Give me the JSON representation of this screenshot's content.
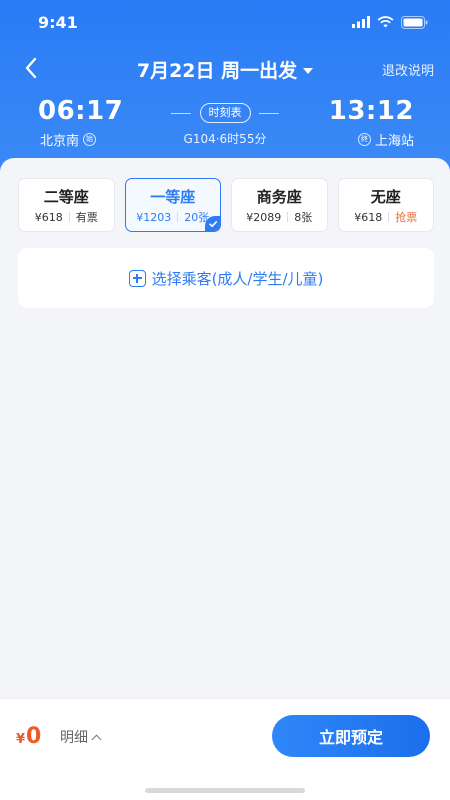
{
  "status_bar": {
    "time": "9:41"
  },
  "nav": {
    "title": "7月22日 周一出发",
    "refund_link": "退改说明"
  },
  "train": {
    "departure_time": "06:17",
    "departure_station": "北京南",
    "departure_badge": "始",
    "arrival_time": "13:12",
    "arrival_station": "上海站",
    "arrival_badge": "终",
    "timetable_label": "时刻表",
    "train_info": "G104·6时55分"
  },
  "seats": [
    {
      "name": "二等座",
      "price": "¥618",
      "availability": "有票",
      "selected": false
    },
    {
      "name": "一等座",
      "price": "¥1203",
      "availability": "20张",
      "selected": true
    },
    {
      "name": "商务座",
      "price": "¥2089",
      "availability": "8张",
      "selected": false
    },
    {
      "name": "无座",
      "price": "¥618",
      "availability": "抢票",
      "selected": false
    }
  ],
  "passenger": {
    "label": "选择乘客(成人/学生/儿童)"
  },
  "footer": {
    "currency": "¥",
    "amount": "0",
    "detail_label": "明细",
    "book_label": "立即预定"
  },
  "colors": {
    "header_blue": "#2a7bf5",
    "accent_blue": "#2d7cf3",
    "price_orange": "#ef5a24"
  }
}
